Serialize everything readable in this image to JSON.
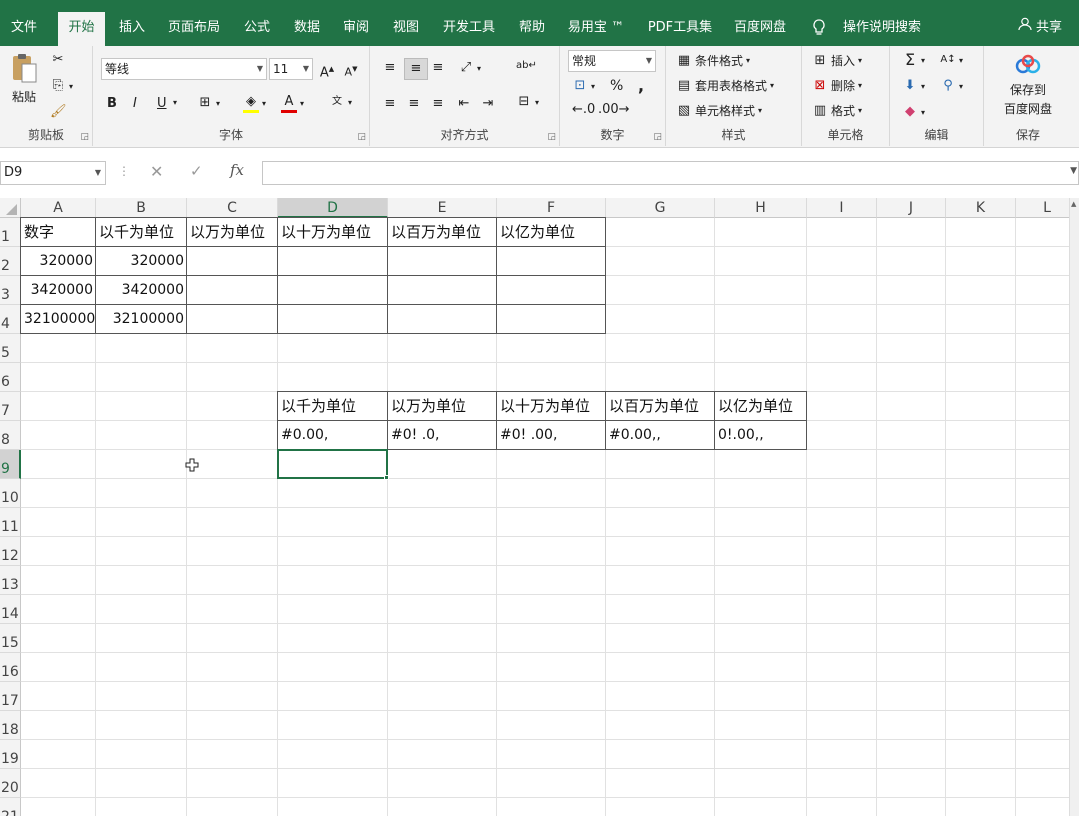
{
  "ribbon_tabs": [
    "文件",
    "开始",
    "插入",
    "页面布局",
    "公式",
    "数据",
    "审阅",
    "视图",
    "开发工具",
    "帮助",
    "易用宝 ™",
    "PDF工具集",
    "百度网盘"
  ],
  "tell_me": "操作说明搜索",
  "share": "共享",
  "clipboard": {
    "paste": "粘贴",
    "label": "剪贴板"
  },
  "font": {
    "name": "等线",
    "size": "11",
    "label": "字体",
    "bold": "B",
    "italic": "I",
    "underline": "U"
  },
  "alignment": {
    "label": "对齐方式"
  },
  "number": {
    "format": "常规",
    "label": "数字",
    "percent": "%",
    "comma": ","
  },
  "styles": {
    "conditional": "条件格式",
    "table": "套用表格格式",
    "cell_styles": "单元格样式",
    "label": "样式"
  },
  "cells": {
    "insert": "插入",
    "delete": "删除",
    "format": "格式",
    "label": "单元格"
  },
  "editing": {
    "label": "编辑"
  },
  "save": {
    "line1": "保存到",
    "line2": "百度网盘",
    "label": "保存"
  },
  "name_box": "D9",
  "formula_value": "",
  "columns": [
    "A",
    "B",
    "C",
    "D",
    "E",
    "F",
    "G",
    "H",
    "I",
    "J",
    "K",
    "L"
  ],
  "rows": [
    "1",
    "2",
    "3",
    "4",
    "5",
    "6",
    "7",
    "8",
    "9",
    "10",
    "11",
    "12",
    "13",
    "14",
    "15",
    "16",
    "17",
    "18",
    "19",
    "20",
    "21"
  ],
  "selected_cell": "D9",
  "table1": {
    "headers": [
      "数字",
      "以千为单位",
      "以万为单位",
      "以十万为单位",
      "以百万为单位",
      "以亿为单位"
    ],
    "rows": [
      [
        "320000",
        "320000",
        "",
        "",
        "",
        ""
      ],
      [
        "3420000",
        "3420000",
        "",
        "",
        "",
        ""
      ],
      [
        "32100000",
        "32100000",
        "",
        "",
        "",
        ""
      ]
    ]
  },
  "table2": {
    "headers": [
      "以千为单位",
      "以万为单位",
      "以十万为单位",
      "以百万为单位",
      "以亿为单位"
    ],
    "formats": [
      "#0.00,",
      "#0!  .0,",
      "#0!  .00,",
      "#0.00,,",
      "0!.00,,"
    ]
  }
}
